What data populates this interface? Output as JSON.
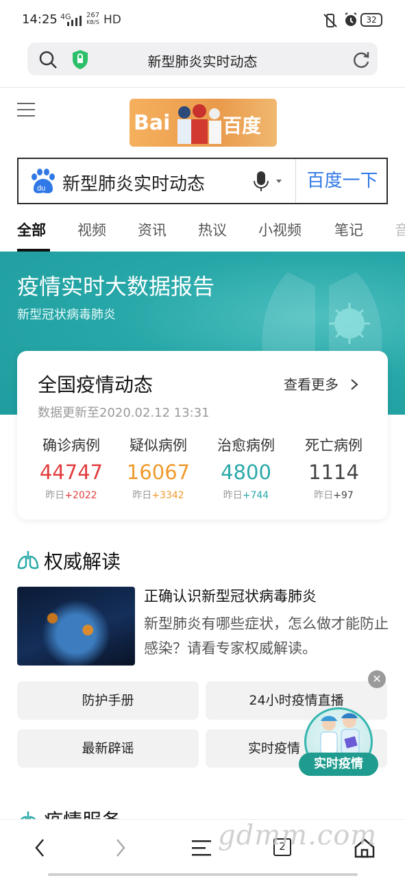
{
  "status_bar": {
    "time": "14:25",
    "network": "4G",
    "speed_value": "267",
    "speed_unit": "KB/S",
    "hd": "HD",
    "battery": "32"
  },
  "address_bar": {
    "title": "新型肺炎实时动态"
  },
  "logo": {
    "text_left": "Bai",
    "text_right": "百度"
  },
  "search": {
    "query": "新型肺炎实时动态",
    "submit_label": "百度一下"
  },
  "tabs": [
    {
      "label": "全部",
      "active": true
    },
    {
      "label": "视频"
    },
    {
      "label": "资讯"
    },
    {
      "label": "热议"
    },
    {
      "label": "小视频"
    },
    {
      "label": "笔记"
    },
    {
      "label": "音"
    }
  ],
  "banner": {
    "title": "疫情实时大数据报告",
    "subtitle": "新型冠状病毒肺炎"
  },
  "stats_card": {
    "title": "全国疫情动态",
    "more_label": "查看更多",
    "updated": "数据更新至2020.02.12 13:31",
    "prev_label": "昨日",
    "items": [
      {
        "label": "确诊病例",
        "value": "44747",
        "change": "+2022",
        "color": "#e23c3c",
        "change_color": "#e23c3c"
      },
      {
        "label": "疑似病例",
        "value": "16067",
        "change": "+3342",
        "color": "#ef9a2c",
        "change_color": "#ef9a2c"
      },
      {
        "label": "治愈病例",
        "value": "4800",
        "change": "+744",
        "color": "#2aa8a8",
        "change_color": "#2aa8a8"
      },
      {
        "label": "死亡病例",
        "value": "1114",
        "change": "+97",
        "color": "#444444",
        "change_color": "#444444"
      }
    ]
  },
  "authority": {
    "title": "权威解读",
    "article_title": "正确认识新型冠状病毒肺炎",
    "article_desc": "新型肺炎有哪些症状，怎么做才能防止感染？请看专家权威解读。",
    "buttons": [
      "防护手册",
      "24小时疫情直播",
      "最新辟谣",
      "实时疫情"
    ]
  },
  "float_badge": {
    "label": "实时疫情"
  },
  "next_section": {
    "title": "疫情服务"
  },
  "bottom_nav": {
    "tab_count": "2"
  },
  "watermark": "gdmm.com",
  "colors": {
    "accent_blue": "#3078e6",
    "teal": "#27a7a8",
    "confirmed": "#e23c3c",
    "suspected": "#ef9a2c",
    "cured": "#2aa8a8"
  }
}
